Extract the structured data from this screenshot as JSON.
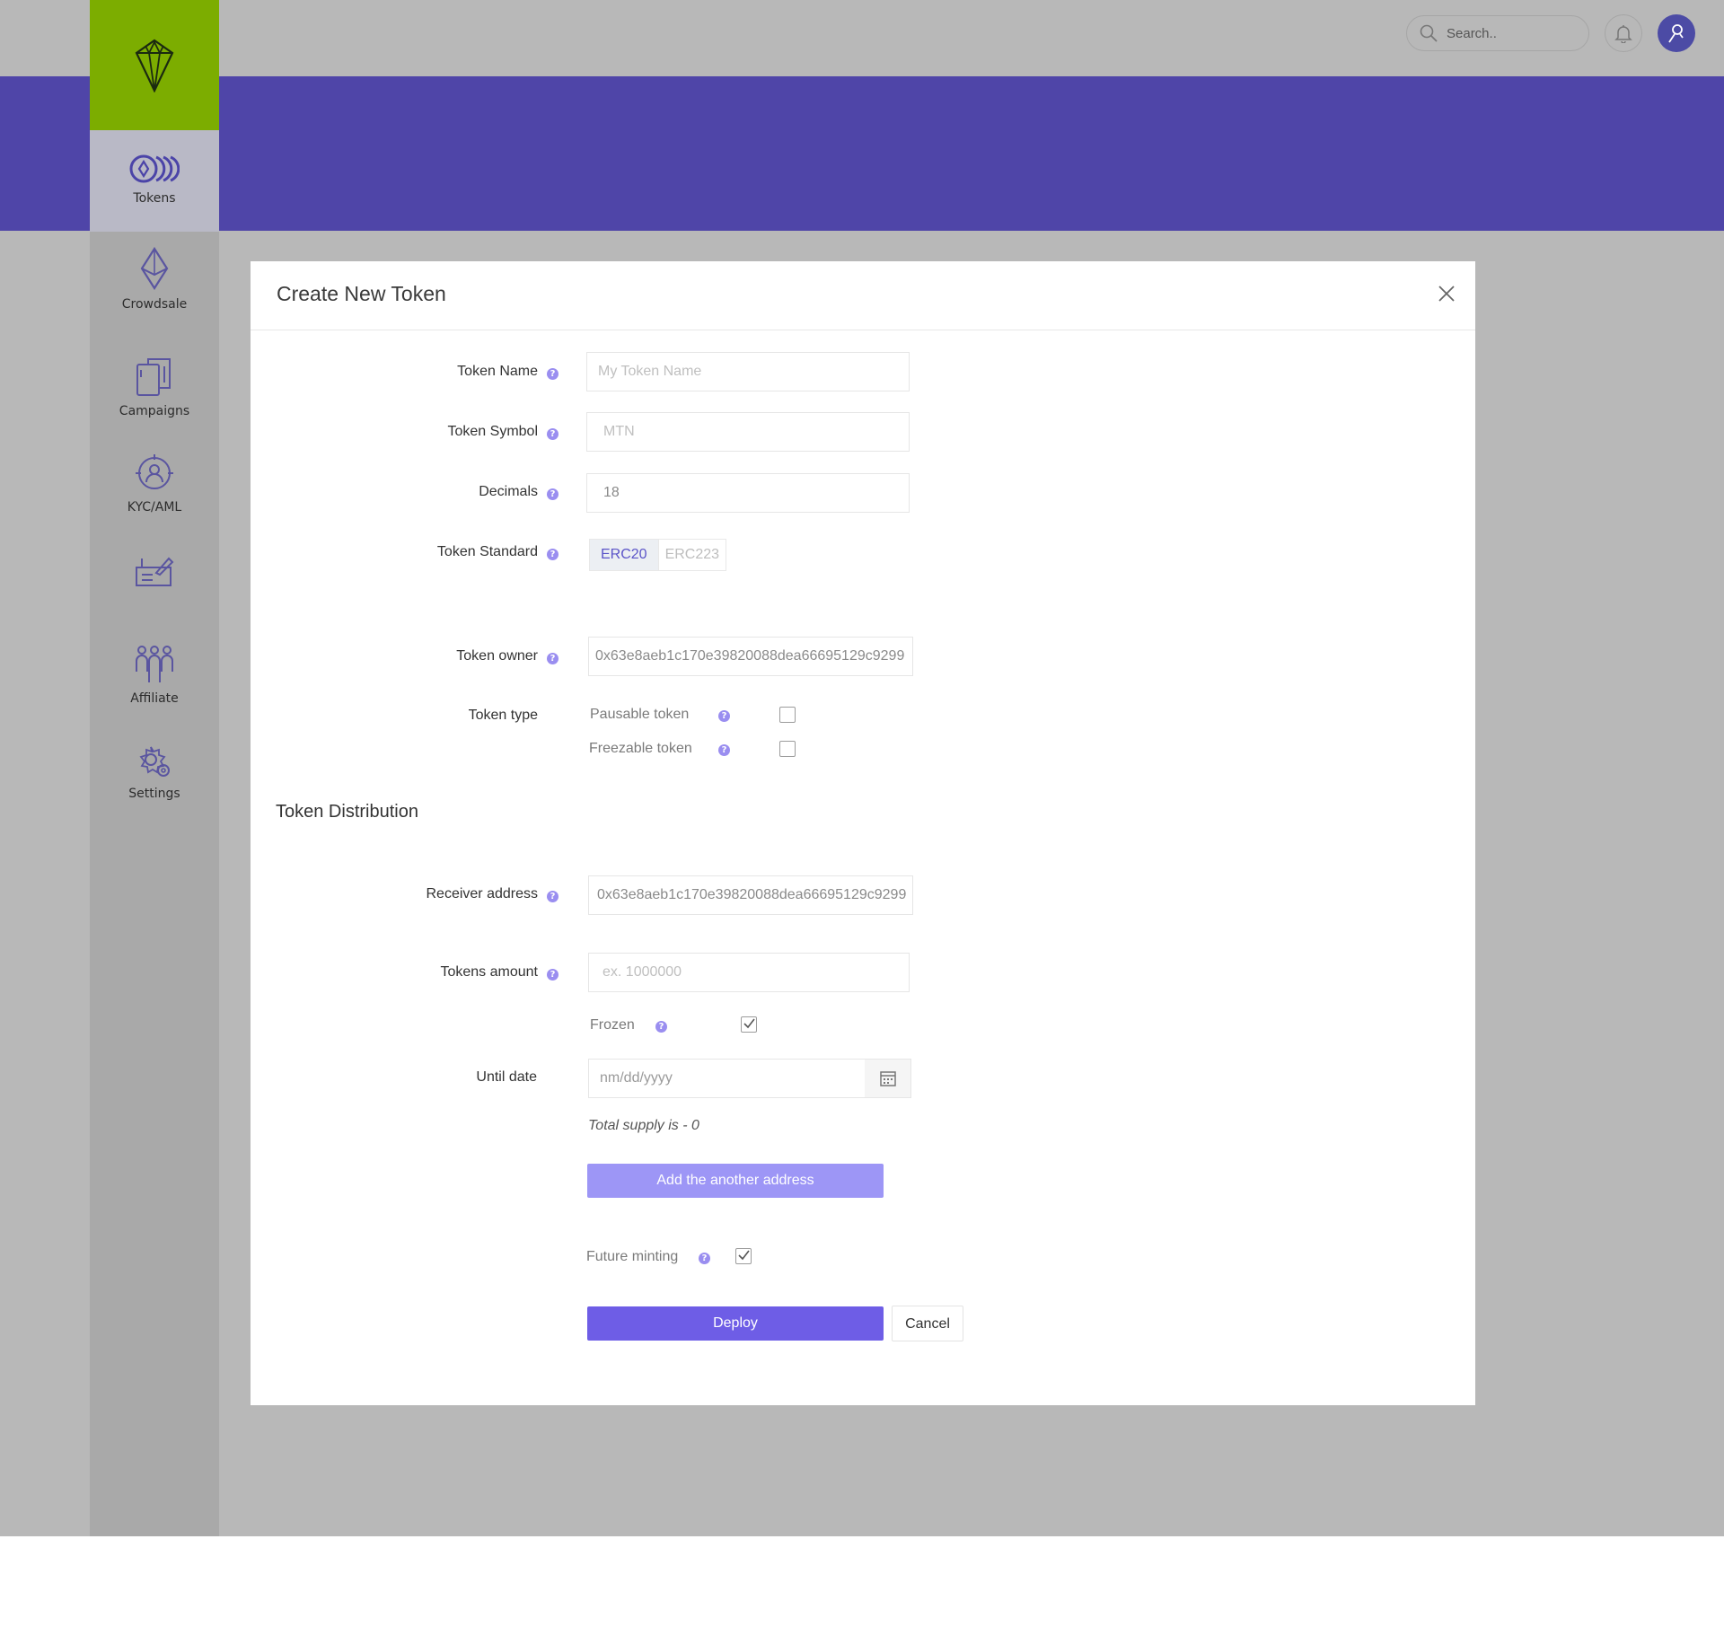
{
  "topbar": {
    "search_placeholder": "Search..",
    "icons": {
      "search": "search-icon",
      "bell": "bell-icon",
      "avatar": "user-icon"
    }
  },
  "sidebar": {
    "items": [
      {
        "label": "Tokens",
        "icon": "tokens-icon",
        "active": true
      },
      {
        "label": "Crowdsale",
        "icon": "ethereum-icon"
      },
      {
        "label": "Campaigns",
        "icon": "campaigns-icon"
      },
      {
        "label": "KYC/AML",
        "icon": "kyc-icon"
      },
      {
        "label": "",
        "icon": "reports-icon"
      },
      {
        "label": "Affiliate",
        "icon": "affiliate-icon"
      },
      {
        "label": "Settings",
        "icon": "settings-icon"
      }
    ]
  },
  "modal": {
    "title": "Create New Token",
    "token_name": {
      "label": "Token Name",
      "placeholder": "My Token Name"
    },
    "token_symbol": {
      "label": "Token Symbol",
      "placeholder": "MTN"
    },
    "decimals": {
      "label": "Decimals",
      "value": "18"
    },
    "token_standard": {
      "label": "Token Standard",
      "options": [
        "ERC20",
        "ERC223"
      ],
      "selected": "ERC20"
    },
    "token_owner": {
      "label": "Token owner",
      "value": "0x63e8aeb1c170e39820088dea66695129c9299"
    },
    "token_type": {
      "label": "Token type",
      "options": [
        {
          "label": "Pausable token",
          "checked": false
        },
        {
          "label": "Freezable token",
          "checked": false
        }
      ]
    },
    "distribution": {
      "title": "Token Distribution",
      "receiver_address": {
        "label": "Receiver address",
        "value": "0x63e8aeb1c170e39820088dea66695129c9299"
      },
      "tokens_amount": {
        "label": "Tokens amount",
        "placeholder": "ex. 1000000"
      },
      "frozen": {
        "label": "Frozen",
        "checked": true
      },
      "until_date": {
        "label": "Until date",
        "placeholder": "nm/dd/yyyy"
      },
      "total_supply": "Total supply is - 0",
      "add_button": "Add the another address"
    },
    "future_minting": {
      "label": "Future minting",
      "checked": true
    },
    "deploy_button": "Deploy",
    "cancel_button": "Cancel",
    "help_glyph": "?"
  },
  "colors": {
    "banner": "#4f45a8",
    "logo_bg": "#7cad00",
    "accent": "#6e5de6",
    "accent_light": "#9d96f6"
  }
}
